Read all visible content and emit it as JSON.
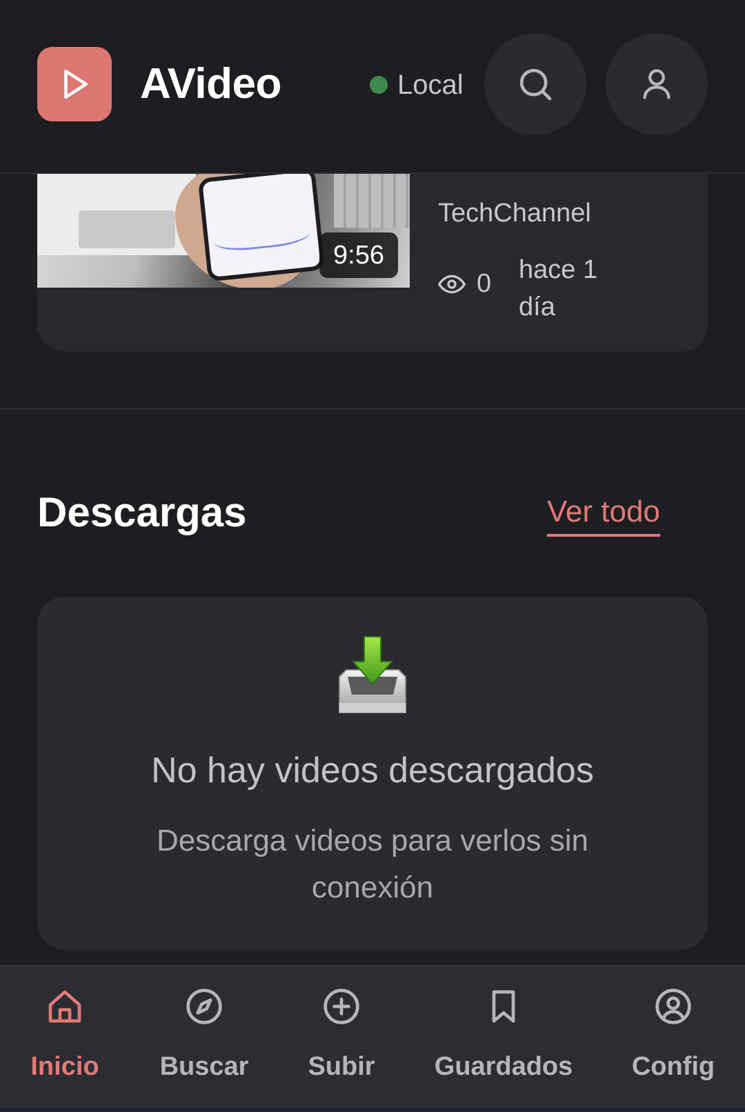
{
  "header": {
    "app_title": "AVideo",
    "status_label": "Local",
    "status_color": "#3e8a4e",
    "brand_color": "#dd7772",
    "icons": {
      "logo": "play-icon",
      "search": "search-icon",
      "account": "user-icon"
    }
  },
  "recent_video": {
    "duration": "9:56",
    "channel": "TechChannel",
    "views": "0",
    "time_ago": "hace 1 día"
  },
  "downloads": {
    "title": "Descargas",
    "see_all": "Ver todo",
    "empty_title": "No hay videos descargados",
    "empty_description": "Descarga videos para verlos sin conexión",
    "empty_icon": "download-tray-icon"
  },
  "bottom_nav": {
    "active_color": "#e07a76",
    "items": [
      {
        "label": "Inicio",
        "icon": "home-icon",
        "active": true
      },
      {
        "label": "Buscar",
        "icon": "compass-icon",
        "active": false
      },
      {
        "label": "Subir",
        "icon": "plus-circle-icon",
        "active": false
      },
      {
        "label": "Guardados",
        "icon": "bookmark-icon",
        "active": false
      },
      {
        "label": "Config",
        "icon": "user-circle-icon",
        "active": false
      }
    ]
  }
}
